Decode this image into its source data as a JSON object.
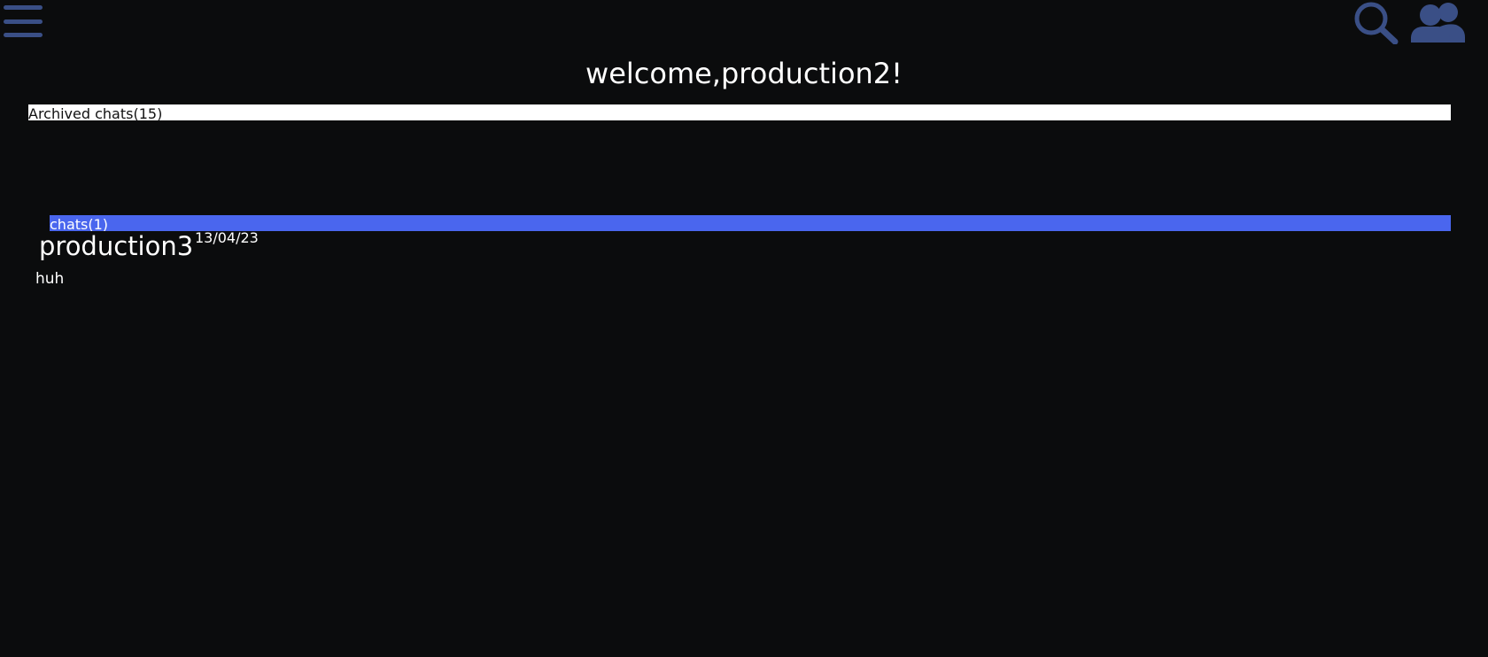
{
  "header": {
    "menu_icon": "hamburger-menu-icon",
    "search_icon": "search-icon",
    "friends_icon": "users-icon",
    "icon_color": "#3a4f86"
  },
  "page": {
    "title": "welcome,production2!",
    "background_color": "#0b0c0d"
  },
  "archived": {
    "label": "Archived chats(15)",
    "background_color": "#ffffff"
  },
  "chats": {
    "label": "chats(1)",
    "background_color": "#4a66ee",
    "items": [
      {
        "name": "production3",
        "date": "13/04/23",
        "preview": "huh"
      }
    ]
  }
}
